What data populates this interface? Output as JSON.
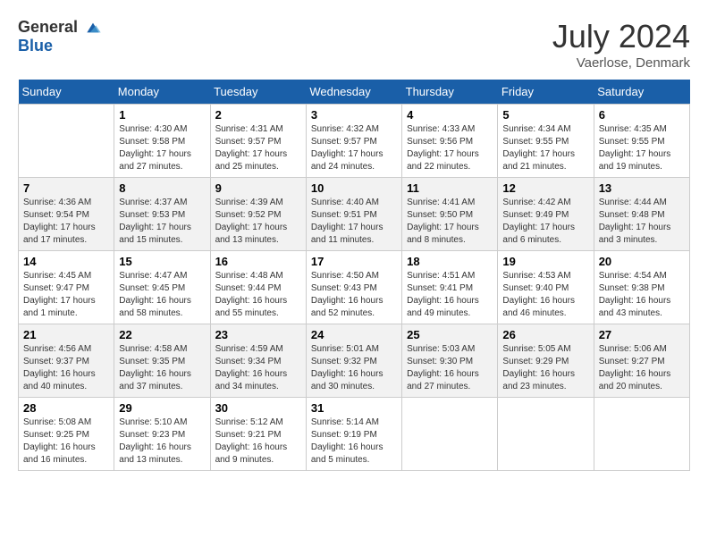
{
  "header": {
    "logo_general": "General",
    "logo_blue": "Blue",
    "month_title": "July 2024",
    "location": "Vaerlose, Denmark"
  },
  "days_of_week": [
    "Sunday",
    "Monday",
    "Tuesday",
    "Wednesday",
    "Thursday",
    "Friday",
    "Saturday"
  ],
  "weeks": [
    [
      {
        "day": "",
        "sunrise": "",
        "sunset": "",
        "daylight": ""
      },
      {
        "day": "1",
        "sunrise": "Sunrise: 4:30 AM",
        "sunset": "Sunset: 9:58 PM",
        "daylight": "Daylight: 17 hours and 27 minutes."
      },
      {
        "day": "2",
        "sunrise": "Sunrise: 4:31 AM",
        "sunset": "Sunset: 9:57 PM",
        "daylight": "Daylight: 17 hours and 25 minutes."
      },
      {
        "day": "3",
        "sunrise": "Sunrise: 4:32 AM",
        "sunset": "Sunset: 9:57 PM",
        "daylight": "Daylight: 17 hours and 24 minutes."
      },
      {
        "day": "4",
        "sunrise": "Sunrise: 4:33 AM",
        "sunset": "Sunset: 9:56 PM",
        "daylight": "Daylight: 17 hours and 22 minutes."
      },
      {
        "day": "5",
        "sunrise": "Sunrise: 4:34 AM",
        "sunset": "Sunset: 9:55 PM",
        "daylight": "Daylight: 17 hours and 21 minutes."
      },
      {
        "day": "6",
        "sunrise": "Sunrise: 4:35 AM",
        "sunset": "Sunset: 9:55 PM",
        "daylight": "Daylight: 17 hours and 19 minutes."
      }
    ],
    [
      {
        "day": "7",
        "sunrise": "Sunrise: 4:36 AM",
        "sunset": "Sunset: 9:54 PM",
        "daylight": "Daylight: 17 hours and 17 minutes."
      },
      {
        "day": "8",
        "sunrise": "Sunrise: 4:37 AM",
        "sunset": "Sunset: 9:53 PM",
        "daylight": "Daylight: 17 hours and 15 minutes."
      },
      {
        "day": "9",
        "sunrise": "Sunrise: 4:39 AM",
        "sunset": "Sunset: 9:52 PM",
        "daylight": "Daylight: 17 hours and 13 minutes."
      },
      {
        "day": "10",
        "sunrise": "Sunrise: 4:40 AM",
        "sunset": "Sunset: 9:51 PM",
        "daylight": "Daylight: 17 hours and 11 minutes."
      },
      {
        "day": "11",
        "sunrise": "Sunrise: 4:41 AM",
        "sunset": "Sunset: 9:50 PM",
        "daylight": "Daylight: 17 hours and 8 minutes."
      },
      {
        "day": "12",
        "sunrise": "Sunrise: 4:42 AM",
        "sunset": "Sunset: 9:49 PM",
        "daylight": "Daylight: 17 hours and 6 minutes."
      },
      {
        "day": "13",
        "sunrise": "Sunrise: 4:44 AM",
        "sunset": "Sunset: 9:48 PM",
        "daylight": "Daylight: 17 hours and 3 minutes."
      }
    ],
    [
      {
        "day": "14",
        "sunrise": "Sunrise: 4:45 AM",
        "sunset": "Sunset: 9:47 PM",
        "daylight": "Daylight: 17 hours and 1 minute."
      },
      {
        "day": "15",
        "sunrise": "Sunrise: 4:47 AM",
        "sunset": "Sunset: 9:45 PM",
        "daylight": "Daylight: 16 hours and 58 minutes."
      },
      {
        "day": "16",
        "sunrise": "Sunrise: 4:48 AM",
        "sunset": "Sunset: 9:44 PM",
        "daylight": "Daylight: 16 hours and 55 minutes."
      },
      {
        "day": "17",
        "sunrise": "Sunrise: 4:50 AM",
        "sunset": "Sunset: 9:43 PM",
        "daylight": "Daylight: 16 hours and 52 minutes."
      },
      {
        "day": "18",
        "sunrise": "Sunrise: 4:51 AM",
        "sunset": "Sunset: 9:41 PM",
        "daylight": "Daylight: 16 hours and 49 minutes."
      },
      {
        "day": "19",
        "sunrise": "Sunrise: 4:53 AM",
        "sunset": "Sunset: 9:40 PM",
        "daylight": "Daylight: 16 hours and 46 minutes."
      },
      {
        "day": "20",
        "sunrise": "Sunrise: 4:54 AM",
        "sunset": "Sunset: 9:38 PM",
        "daylight": "Daylight: 16 hours and 43 minutes."
      }
    ],
    [
      {
        "day": "21",
        "sunrise": "Sunrise: 4:56 AM",
        "sunset": "Sunset: 9:37 PM",
        "daylight": "Daylight: 16 hours and 40 minutes."
      },
      {
        "day": "22",
        "sunrise": "Sunrise: 4:58 AM",
        "sunset": "Sunset: 9:35 PM",
        "daylight": "Daylight: 16 hours and 37 minutes."
      },
      {
        "day": "23",
        "sunrise": "Sunrise: 4:59 AM",
        "sunset": "Sunset: 9:34 PM",
        "daylight": "Daylight: 16 hours and 34 minutes."
      },
      {
        "day": "24",
        "sunrise": "Sunrise: 5:01 AM",
        "sunset": "Sunset: 9:32 PM",
        "daylight": "Daylight: 16 hours and 30 minutes."
      },
      {
        "day": "25",
        "sunrise": "Sunrise: 5:03 AM",
        "sunset": "Sunset: 9:30 PM",
        "daylight": "Daylight: 16 hours and 27 minutes."
      },
      {
        "day": "26",
        "sunrise": "Sunrise: 5:05 AM",
        "sunset": "Sunset: 9:29 PM",
        "daylight": "Daylight: 16 hours and 23 minutes."
      },
      {
        "day": "27",
        "sunrise": "Sunrise: 5:06 AM",
        "sunset": "Sunset: 9:27 PM",
        "daylight": "Daylight: 16 hours and 20 minutes."
      }
    ],
    [
      {
        "day": "28",
        "sunrise": "Sunrise: 5:08 AM",
        "sunset": "Sunset: 9:25 PM",
        "daylight": "Daylight: 16 hours and 16 minutes."
      },
      {
        "day": "29",
        "sunrise": "Sunrise: 5:10 AM",
        "sunset": "Sunset: 9:23 PM",
        "daylight": "Daylight: 16 hours and 13 minutes."
      },
      {
        "day": "30",
        "sunrise": "Sunrise: 5:12 AM",
        "sunset": "Sunset: 9:21 PM",
        "daylight": "Daylight: 16 hours and 9 minutes."
      },
      {
        "day": "31",
        "sunrise": "Sunrise: 5:14 AM",
        "sunset": "Sunset: 9:19 PM",
        "daylight": "Daylight: 16 hours and 5 minutes."
      },
      {
        "day": "",
        "sunrise": "",
        "sunset": "",
        "daylight": ""
      },
      {
        "day": "",
        "sunrise": "",
        "sunset": "",
        "daylight": ""
      },
      {
        "day": "",
        "sunrise": "",
        "sunset": "",
        "daylight": ""
      }
    ]
  ]
}
